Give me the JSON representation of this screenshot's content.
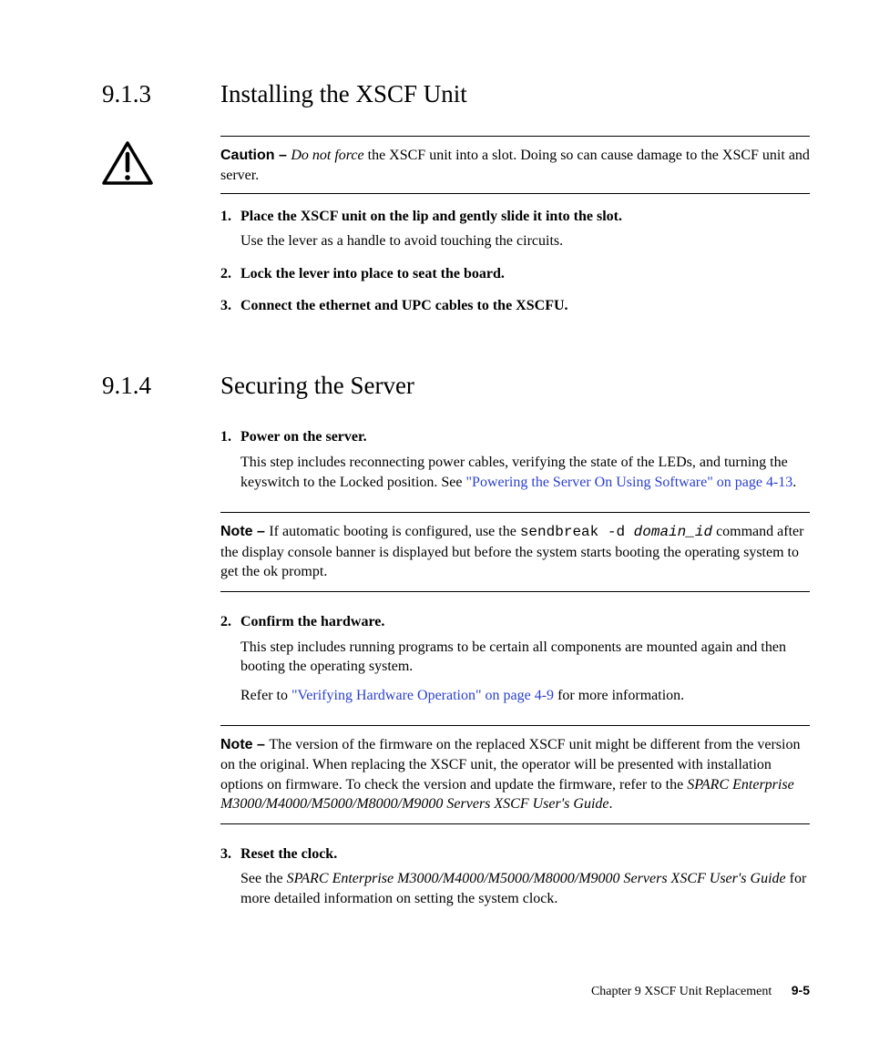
{
  "section913": {
    "num": "9.1.3",
    "title": "Installing the XSCF Unit",
    "caution": {
      "label": "Caution – ",
      "emph": "Do not force",
      "rest": " the XSCF unit into a slot. Doing so can cause damage to the XSCF unit and server."
    },
    "steps": [
      {
        "n": "1.",
        "title": "Place the XSCF unit on the lip and gently slide it into the slot.",
        "body": "Use the lever as a handle to avoid touching the circuits."
      },
      {
        "n": "2.",
        "title": "Lock the lever into place to seat the board."
      },
      {
        "n": "3.",
        "title": "Connect the ethernet and UPC cables to the XSCFU."
      }
    ]
  },
  "section914": {
    "num": "9.1.4",
    "title": "Securing the Server",
    "step1": {
      "n": "1.",
      "title": "Power on the server.",
      "body_before_link": "This step includes reconnecting power cables, verifying the state of the LEDs, and turning the keyswitch to the Locked position. See ",
      "link": "\"Powering the Server On Using Software\" on page 4-13",
      "body_after_link": "."
    },
    "note1": {
      "label": "Note – ",
      "before_code": "If automatic booting is configured, use the ",
      "code": "sendbreak -d",
      "italic_arg": "  domain_id",
      "after": " command after the display console banner is displayed but before the system starts booting the operating system to get the ok prompt."
    },
    "step2": {
      "n": "2.",
      "title": "Confirm the hardware.",
      "body1": "This step includes running programs to be certain all components are mounted again and then booting the operating system.",
      "body2_before": "Refer to ",
      "link": "\"Verifying Hardware Operation\" on page 4-9",
      "body2_after": " for more information."
    },
    "note2": {
      "label": "Note – ",
      "text_before_italic": "The version of the firmware on the replaced XSCF unit might be different from the version on the original. When replacing the XSCF unit, the operator will be presented with installation options on firmware. To check the version and update the firmware, refer to the ",
      "italic": "SPARC Enterprise M3000/M4000/M5000/M8000/M9000 Servers XSCF User's Guide",
      "text_after_italic": "."
    },
    "step3": {
      "n": "3.",
      "title": "Reset the clock.",
      "body_before": "See the ",
      "italic": "SPARC Enterprise M3000/M4000/M5000/M8000/M9000 Servers XSCF User's Guide",
      "body_after": " for more detailed information on setting the system clock."
    }
  },
  "footer": {
    "chapter": "Chapter 9    XSCF Unit Replacement",
    "page": "9-5"
  }
}
